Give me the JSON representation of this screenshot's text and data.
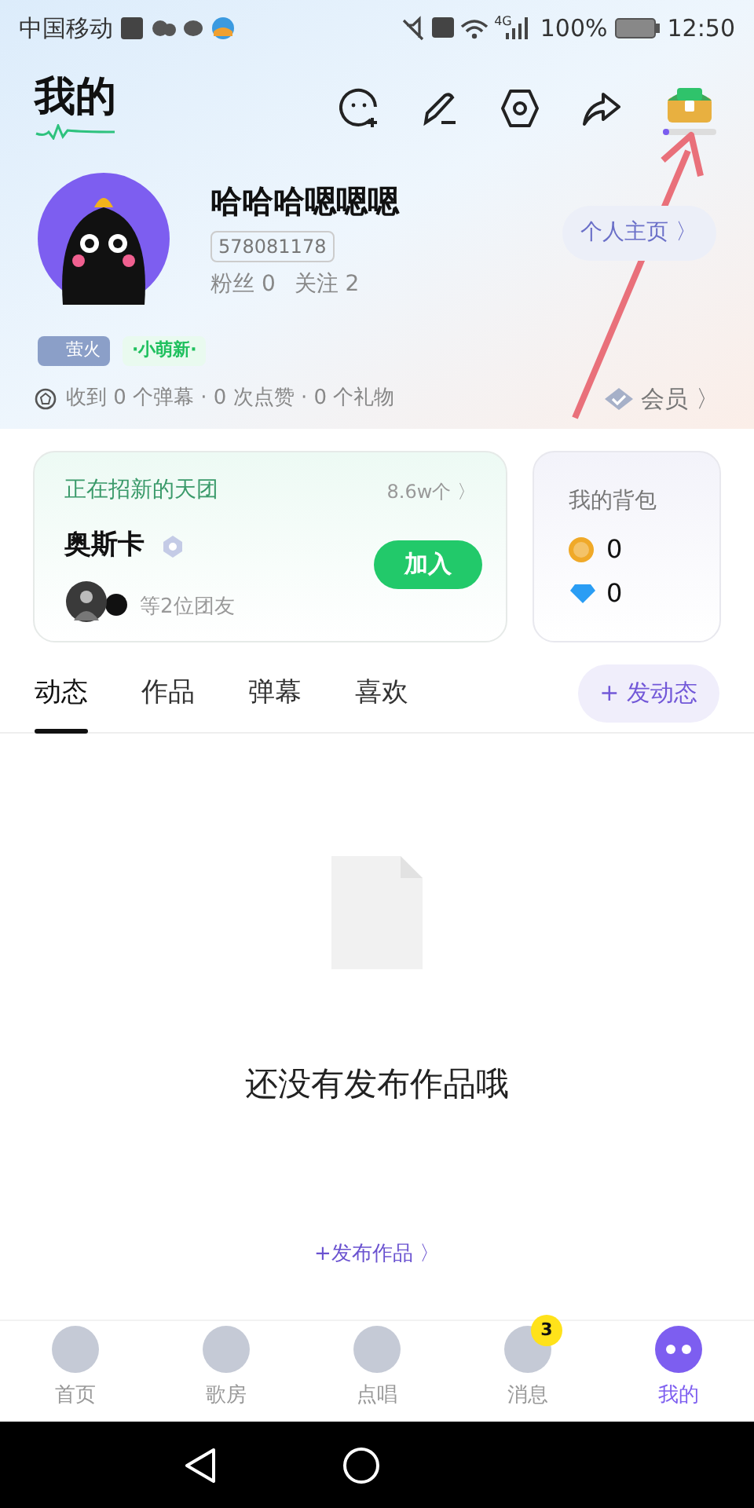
{
  "status_bar": {
    "carrier": "中国移动",
    "network": "4G",
    "battery": "100%",
    "time": "12:50"
  },
  "header": {
    "title": "我的"
  },
  "profile": {
    "name": "哈哈哈嗯嗯嗯",
    "id": "578081178",
    "fans": "粉丝 0",
    "follows": "关注 2",
    "homepage_button": "个人主页 〉"
  },
  "badges": [
    {
      "label": "萤火",
      "kind": "level"
    },
    {
      "label": "·小萌新·",
      "kind": "new"
    }
  ],
  "stats": "收到 0 个弹幕 · 0 次点赞 · 0 个礼物",
  "vip_link": "会员 〉",
  "group_card": {
    "heading": "正在招新的天团",
    "count": "8.6w个 〉",
    "name": "奥斯卡",
    "members": "等2位团友",
    "join_button": "加入"
  },
  "backpack": {
    "title": "我的背包",
    "coins": "0",
    "diamonds": "0"
  },
  "tabs": [
    {
      "label": "动态",
      "selected": true
    },
    {
      "label": "作品",
      "selected": false
    },
    {
      "label": "弹幕",
      "selected": false
    },
    {
      "label": "喜欢",
      "selected": false
    }
  ],
  "post_button": "+ 发动态",
  "empty_state": {
    "message": "还没有发布作品哦",
    "link": "+发布作品 〉"
  },
  "bottom_nav": [
    {
      "label": "首页",
      "selected": false
    },
    {
      "label": "歌房",
      "selected": false
    },
    {
      "label": "点唱",
      "selected": false
    },
    {
      "label": "消息",
      "selected": false,
      "badge": "3"
    },
    {
      "label": "我的",
      "selected": true
    }
  ]
}
